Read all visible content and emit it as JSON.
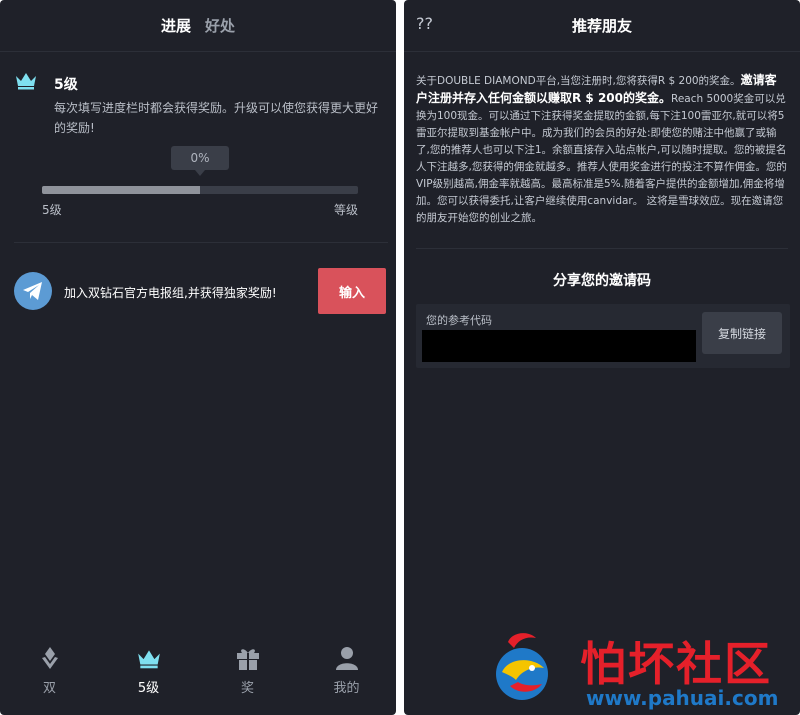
{
  "left": {
    "tabs": [
      {
        "label": "进展",
        "active": true
      },
      {
        "label": "好处",
        "active": false
      }
    ],
    "level": {
      "title": "5级",
      "description": "每次填写进度栏时都会获得奖励。升级可以使您获得更大更好的奖励!",
      "progress_label": "0%",
      "progress_fraction": 0.5,
      "bar_left_label": "5级",
      "bar_right_label": "等级"
    },
    "telegram": {
      "text": "加入双钻石官方电报组,并获得独家奖励!",
      "button_label": "输入"
    },
    "nav": [
      {
        "label": "双",
        "icon": "diamond-icon",
        "active": false
      },
      {
        "label": "5级",
        "icon": "crown-icon",
        "active": true
      },
      {
        "label": "奖",
        "icon": "gift-icon",
        "active": false
      },
      {
        "label": "我的",
        "icon": "user-icon",
        "active": false
      }
    ]
  },
  "right": {
    "back_label": "??",
    "title": "推荐朋友",
    "body_part1": "关于DOUBLE DIAMOND平台,当您注册时,您将获得R $ 200的奖金。",
    "body_highlight": "邀请客户注册并存入任何金额以赚取R $ 200的奖金。",
    "body_part2": "Reach 5000奖金可以兑换为100现金。可以通过下注获得奖金提取的金额,每下注100雷亚尔,就可以将5雷亚尔提取到基金帐户中。成为我们的会员的好处:即使您的赌注中他赢了或输了,您的推荐人也可以下注1。余额直接存入站点帐户,可以随时提取。您的被提名人下注越多,您获得的佣金就越多。推荐人使用奖金进行的投注不算作佣金。您的VIP级别越高,佣金率就越高。最高标准是5%.随着客户提供的金额增加,佣金将增加。您可以获得委托,让客户继续使用canvidar。 这将是雪球效应。现在邀请您的朋友开始您的创业之旅。",
    "share_title": "分享您的邀请码",
    "code_label": "您的参考代码",
    "copy_label": "复制链接"
  },
  "watermark": {
    "cn": "怕坏社区",
    "url": "www.pahuai.com"
  },
  "colors": {
    "panel_bg": "#1f2129",
    "accent_red": "#d9525b",
    "crown_cyan": "#7fe0f0",
    "telegram_blue": "#5c9bd4",
    "watermark_red": "#e5202a",
    "watermark_blue": "#1f79c8"
  }
}
